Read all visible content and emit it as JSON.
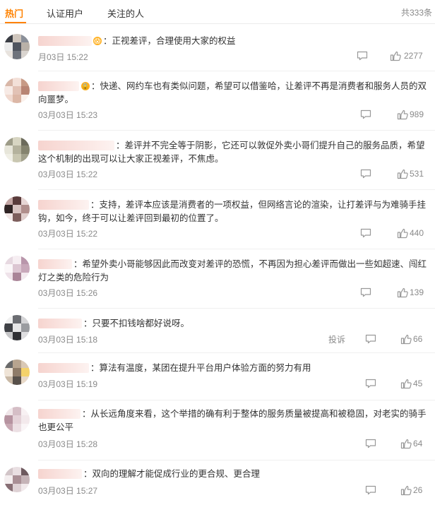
{
  "tabs": [
    {
      "label": "热门",
      "active": true
    },
    {
      "label": "认证用户",
      "active": false
    },
    {
      "label": "关注的人",
      "active": false
    }
  ],
  "total_label": "共333条",
  "accent_color": "#ff8200",
  "comments": [
    {
      "badge": "😱",
      "text": "：正视差评，合理使用大家的权益",
      "time": "月03日 15:22",
      "likes": "2277",
      "report": ""
    },
    {
      "badge": "🔒",
      "text": "：快递、网约车也有类似问题，希望可以借鉴哈，让差评不再是消费者和服务人员的双向噩梦。",
      "time": "03月03日 15:23",
      "likes": "989",
      "report": ""
    },
    {
      "badge": "",
      "text": "：差评并不完全等于阴影，它还可以敦促外卖小哥们提升自己的服务品质，希望这个机制的出现可以让大家正视差评，不焦虑。",
      "time": "03月03日 15:22",
      "likes": "531",
      "report": ""
    },
    {
      "badge": "",
      "text": "：支持，差评本应该是消费者的一项权益，但网络言论的渲染，让打差评与为难骑手挂钩，如今，终于可以让差评回到最初的位置了。",
      "time": "03月03日 15:22",
      "likes": "440",
      "report": ""
    },
    {
      "badge": "",
      "text": "：希望外卖小哥能够因此而改变对差评的恐慌，不再因为担心差评而做出一些如超速、闯红灯之类的危险行为",
      "time": "03月03日 15:26",
      "likes": "139",
      "report": ""
    },
    {
      "badge": "",
      "text": "：只要不扣钱啥都好说呀。",
      "time": "03月03日 15:18",
      "likes": "66",
      "report": "投诉"
    },
    {
      "badge": "",
      "text": "：算法有温度，某团在提升平台用户体验方面的努力有用",
      "time": "03月03日 15:19",
      "likes": "45",
      "report": ""
    },
    {
      "badge": "",
      "text": "：从长远角度来看，这个举措的确有利于整体的服务质量被提高和被稳固，对老实的骑手也更公平",
      "time": "03月03日 15:28",
      "likes": "64",
      "report": ""
    },
    {
      "badge": "",
      "text": "：双向的理解才能促成行业的更合规、更合理",
      "time": "03月03日 15:27",
      "likes": "26",
      "report": ""
    }
  ]
}
